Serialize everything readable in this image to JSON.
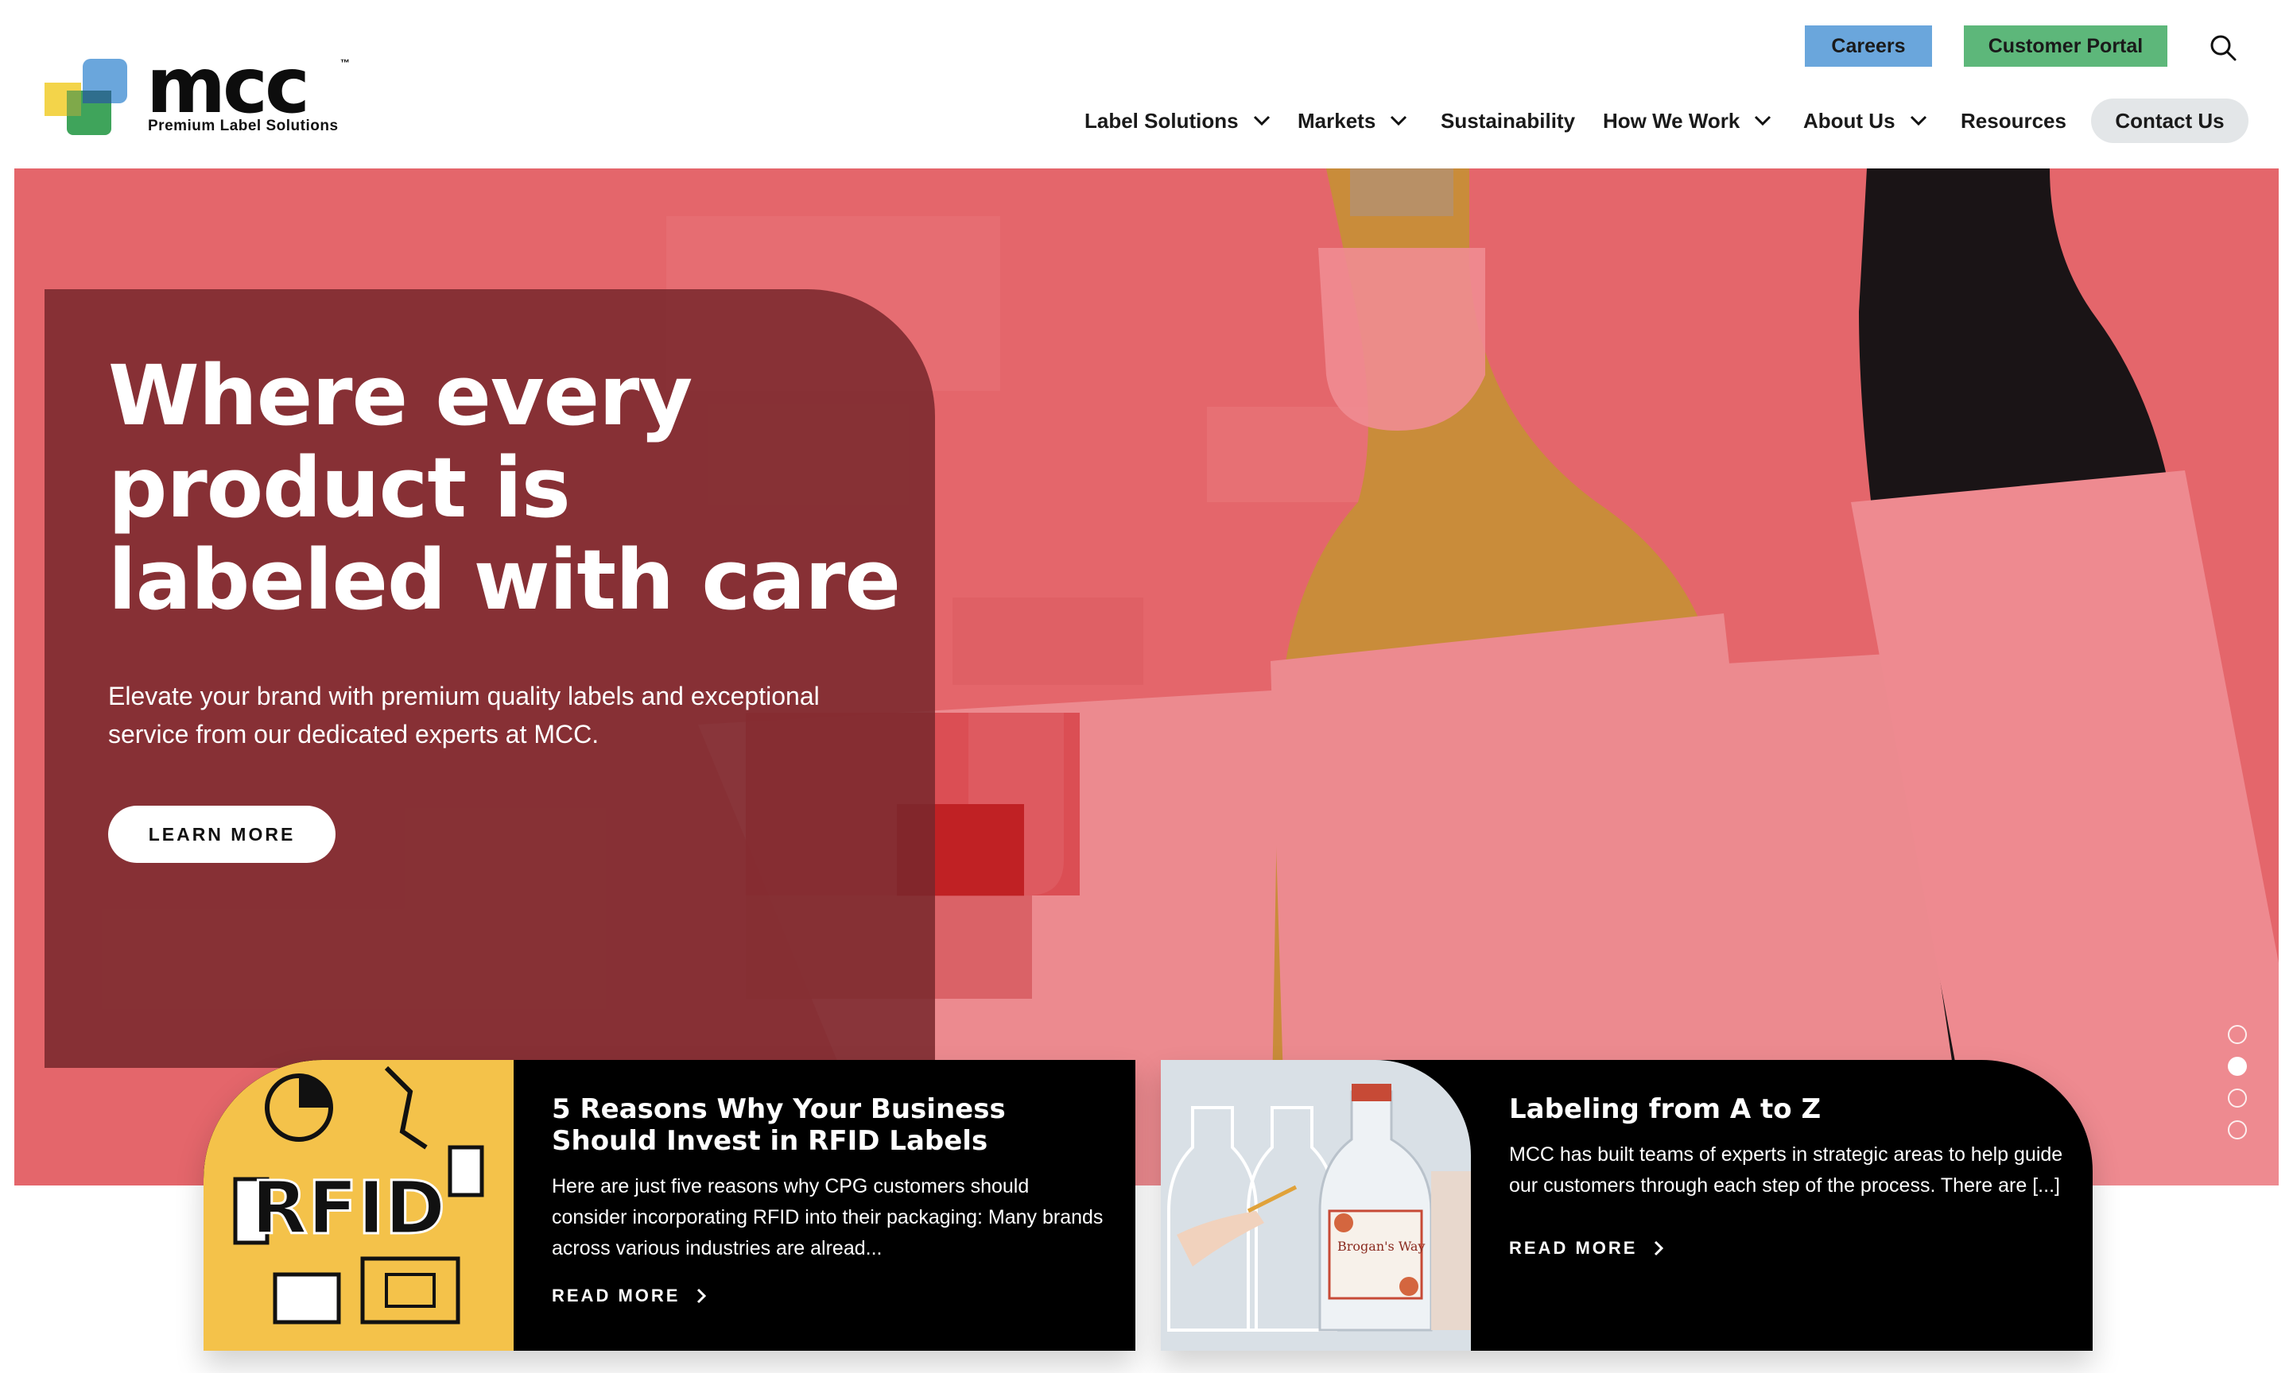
{
  "brand": {
    "wordmark": "mcc",
    "trademark": "™",
    "tagline": "Premium Label Solutions",
    "colors": {
      "blue": "#6aa6dc",
      "yellow": "#f3d44a",
      "green": "#3fa45b"
    }
  },
  "header": {
    "careers_label": "Careers",
    "portal_label": "Customer Portal",
    "search_icon": "search-icon",
    "nav": [
      {
        "label": "Label Solutions",
        "dropdown": true
      },
      {
        "label": "Markets",
        "dropdown": true
      },
      {
        "label": "Sustainability",
        "dropdown": false
      },
      {
        "label": "How We Work",
        "dropdown": true
      },
      {
        "label": "About Us",
        "dropdown": true
      },
      {
        "label": "Resources",
        "dropdown": false
      }
    ],
    "contact_label": "Contact Us"
  },
  "hero": {
    "title": "Where every product is labeled with care",
    "subtitle": "Elevate your brand with premium quality labels and exceptional service from our dedicated experts at MCC.",
    "cta_label": "LEARN MORE",
    "slides": 4,
    "active_slide": 2,
    "colors": {
      "background": "#e4666b",
      "panel": "#78282c"
    }
  },
  "cards": [
    {
      "title": "5 Reasons Why Your Business Should Invest in RFID Labels",
      "text": "Here are just five reasons why CPG customers should consider incorporating RFID into their packaging: Many brands across various industries are alread...",
      "link_label": "READ MORE",
      "image_text": "RFID"
    },
    {
      "title": "Labeling from A to Z",
      "text": "MCC has built teams of experts in strategic areas to help guide our customers through each step of the process. There are [...]",
      "link_label": "READ MORE",
      "image_text": "Brogan's Way"
    }
  ]
}
